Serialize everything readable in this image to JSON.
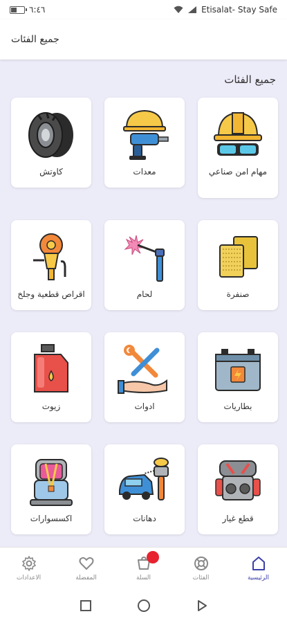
{
  "status_bar": {
    "time": "٦:٤٦",
    "carrier": "Etisalat- Stay Safe",
    "battery_percent": 45
  },
  "appbar": {
    "title": "جميع الفئات"
  },
  "section_title": "جميع الفئات",
  "categories": [
    {
      "label": "مهام امن صناعي",
      "icon": "safety-helmet-goggles-icon"
    },
    {
      "label": "معدات",
      "icon": "power-drill-helmet-icon"
    },
    {
      "label": "كاوتش",
      "icon": "tire-icon"
    },
    {
      "label": "صنفرة",
      "icon": "sandpaper-icon"
    },
    {
      "label": "لحام",
      "icon": "welding-torch-icon"
    },
    {
      "label": "اقراص قطعية وجلخ",
      "icon": "grinder-disc-icon"
    },
    {
      "label": "بطاريات",
      "icon": "car-battery-icon"
    },
    {
      "label": "ادوات",
      "icon": "tools-hand-icon"
    },
    {
      "label": "زيوت",
      "icon": "oil-jerrycan-icon"
    },
    {
      "label": "قطع غيار",
      "icon": "engine-parts-icon"
    },
    {
      "label": "دهانات",
      "icon": "spray-gun-car-icon"
    },
    {
      "label": "اكسسوارات",
      "icon": "car-seat-icon"
    }
  ],
  "bottom_nav": [
    {
      "label": "الرئيسية",
      "icon": "home-icon",
      "active": true
    },
    {
      "label": "الفئات",
      "icon": "lifebuoy-icon",
      "active": false
    },
    {
      "label": "السلة",
      "icon": "cart-icon",
      "active": false
    },
    {
      "label": "المفضلة",
      "icon": "heart-icon",
      "active": false
    },
    {
      "label": "الاعدادات",
      "icon": "gear-icon",
      "active": false
    }
  ],
  "colors": {
    "background": "#ecebf8",
    "accent": "#3b3fa8",
    "badge": "#e6232f"
  }
}
